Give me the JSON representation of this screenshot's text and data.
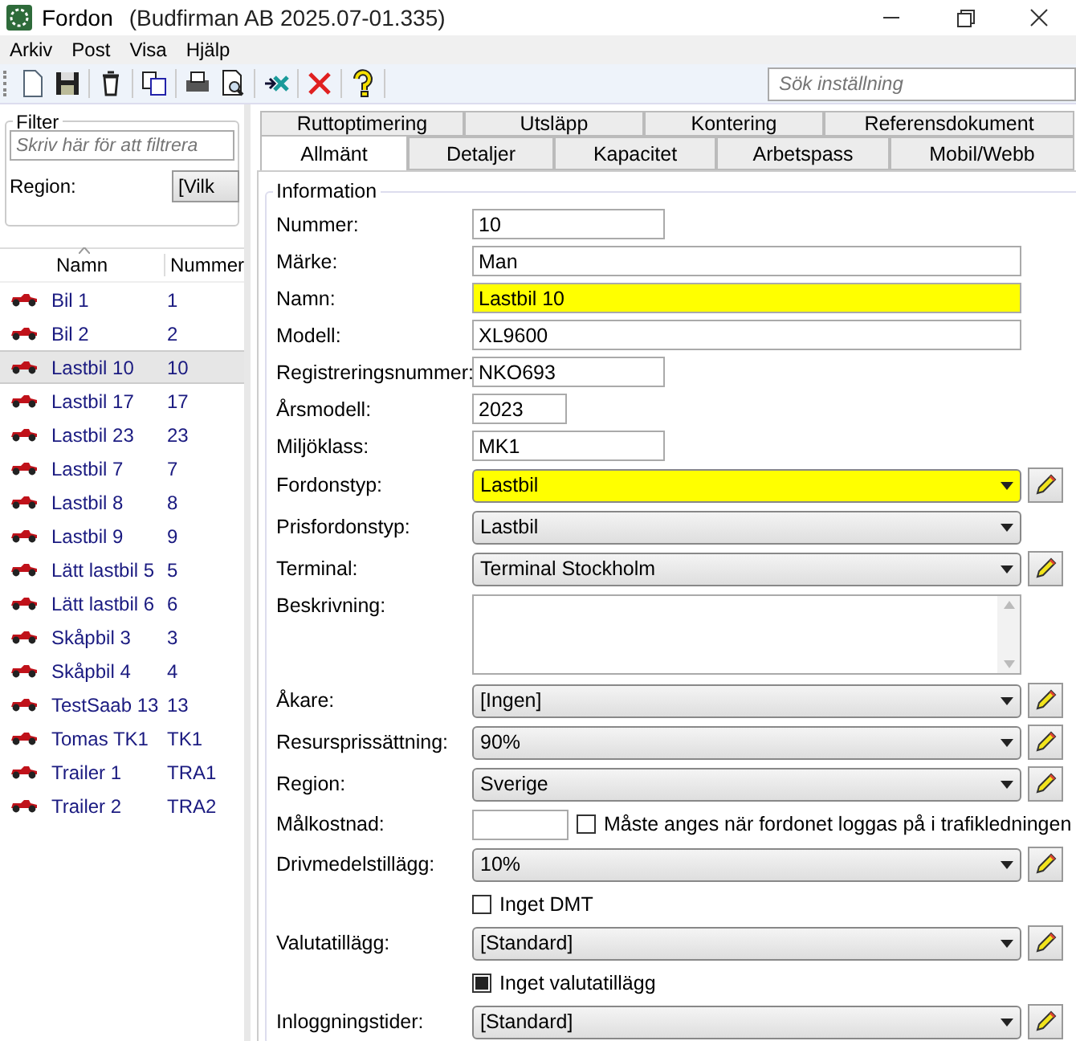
{
  "window": {
    "title": "Fordon",
    "subtitle": "(Budfirman AB 2025.07-01.335)"
  },
  "menu": [
    "Arkiv",
    "Post",
    "Visa",
    "Hjälp"
  ],
  "toolbar": {
    "search": {
      "placeholder": "Sök inställning"
    }
  },
  "filter": {
    "title": "Filter",
    "placeholder": "Skriv här för att filtrera",
    "region_label": "Region:",
    "region_value": "[Vilk"
  },
  "list": {
    "columns": [
      "Namn",
      "Nummer"
    ],
    "rows": [
      {
        "name": "Bil 1",
        "number": "1",
        "selected": false
      },
      {
        "name": "Bil 2",
        "number": "2",
        "selected": false
      },
      {
        "name": "Lastbil 10",
        "number": "10",
        "selected": true
      },
      {
        "name": "Lastbil 17",
        "number": "17",
        "selected": false
      },
      {
        "name": "Lastbil 23",
        "number": "23",
        "selected": false
      },
      {
        "name": "Lastbil 7",
        "number": "7",
        "selected": false
      },
      {
        "name": "Lastbil 8",
        "number": "8",
        "selected": false
      },
      {
        "name": "Lastbil 9",
        "number": "9",
        "selected": false
      },
      {
        "name": "Lätt lastbil 5",
        "number": "5",
        "selected": false
      },
      {
        "name": "Lätt lastbil 6",
        "number": "6",
        "selected": false
      },
      {
        "name": "Skåpbil 3",
        "number": "3",
        "selected": false
      },
      {
        "name": "Skåpbil 4",
        "number": "4",
        "selected": false
      },
      {
        "name": "TestSaab 13",
        "number": "13",
        "selected": false
      },
      {
        "name": "Tomas TK1",
        "number": "TK1",
        "selected": false
      },
      {
        "name": "Trailer 1",
        "number": "TRA1",
        "selected": false
      },
      {
        "name": "Trailer 2",
        "number": "TRA2",
        "selected": false
      }
    ]
  },
  "tabs_back": [
    {
      "label": "Ruttoptimering",
      "selected": false
    },
    {
      "label": "Utsläpp",
      "selected": false
    },
    {
      "label": "Kontering",
      "selected": false
    },
    {
      "label": "Referensdokument",
      "selected": false
    }
  ],
  "tabs_front": [
    {
      "label": "Allmänt",
      "selected": true
    },
    {
      "label": "Detaljer",
      "selected": false
    },
    {
      "label": "Kapacitet",
      "selected": false
    },
    {
      "label": "Arbetspass",
      "selected": false
    },
    {
      "label": "Mobil/Webb",
      "selected": false
    }
  ],
  "form": {
    "title": "Information",
    "fields": [
      {
        "kind": "short",
        "label": "Nummer:",
        "value": "10",
        "highlighted": false
      },
      {
        "kind": "wide",
        "label": "Märke:",
        "value": "Man",
        "highlighted": false
      },
      {
        "kind": "wide",
        "label": "Namn:",
        "value": "Lastbil 10",
        "highlighted": true
      },
      {
        "kind": "wide",
        "label": "Modell:",
        "value": "XL9600",
        "highlighted": false
      },
      {
        "kind": "short",
        "label": "Registreringsnummer:",
        "value": "NKO693",
        "highlighted": false
      },
      {
        "kind": "year",
        "label": "Årsmodell:",
        "value": "2023",
        "highlighted": false
      },
      {
        "kind": "short",
        "label": "Miljöklass:",
        "value": "MK1",
        "highlighted": false
      },
      {
        "kind": "combo",
        "label": "Fordonstyp:",
        "value": "Lastbil",
        "highlighted": true,
        "editable": true
      },
      {
        "kind": "combo",
        "label": "Prisfordonstyp:",
        "value": "Lastbil",
        "highlighted": false,
        "editable": false
      },
      {
        "kind": "combo",
        "label": "Terminal:",
        "value": "Terminal Stockholm",
        "highlighted": false,
        "editable": true
      },
      {
        "kind": "memo",
        "label": "Beskrivning:"
      },
      {
        "kind": "combo",
        "label": "Åkare:",
        "value": "[Ingen]",
        "highlighted": false,
        "editable": true
      },
      {
        "kind": "combo",
        "label": "Resursprissättning:",
        "value": "90%",
        "highlighted": false,
        "editable": true
      },
      {
        "kind": "combo",
        "label": "Region:",
        "value": "Sverige",
        "highlighted": false,
        "editable": true
      },
      {
        "kind": "cost",
        "label": "Målkostnad:",
        "check_label": "Måste anges när fordonet loggas på i trafikledningen",
        "checked": false
      },
      {
        "kind": "combo",
        "label": "Drivmedelstillägg:",
        "value": "10%",
        "highlighted": false,
        "editable": true
      },
      {
        "kind": "check",
        "check_label": "Inget DMT",
        "checked": false
      },
      {
        "kind": "combo",
        "label": "Valutatillägg:",
        "value": "[Standard]",
        "highlighted": false,
        "editable": true
      },
      {
        "kind": "check",
        "check_label": "Inget valutatillägg",
        "checked": true
      },
      {
        "kind": "combo",
        "label": "Inloggningstider:",
        "value": "[Standard]",
        "highlighted": false,
        "editable": true
      }
    ]
  }
}
